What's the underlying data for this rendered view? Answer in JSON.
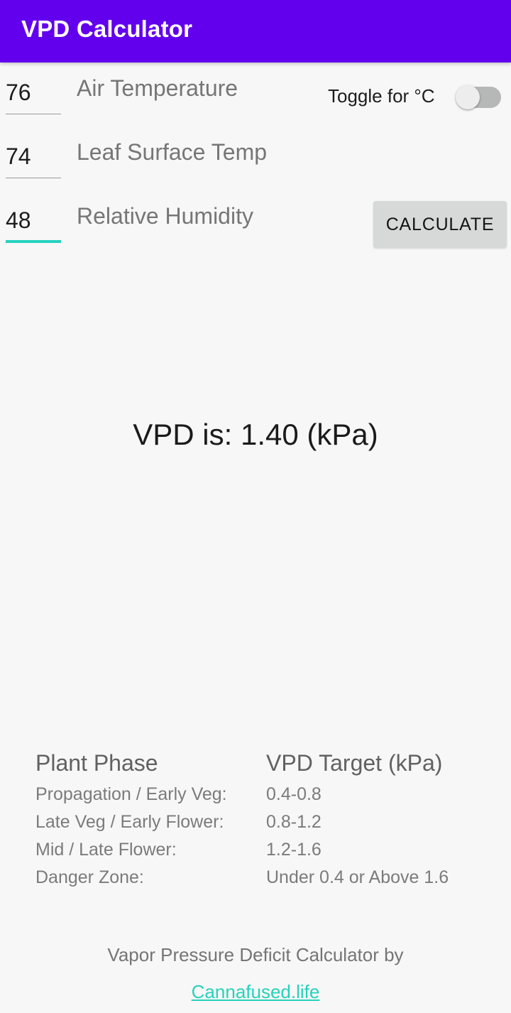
{
  "appbar": {
    "title": "VPD Calculator",
    "background_color": "#6200ee",
    "title_color": "#ffffff"
  },
  "theme": {
    "background_color": "#f7f7f7",
    "accent_color": "#26d2c0",
    "link_color": "#26d2bb",
    "label_color": "#767676",
    "button_color": "#d7d8d8"
  },
  "form": {
    "fields": [
      {
        "name": "air-temperature",
        "value": "76",
        "placeholder": "",
        "label": "Air Temperature",
        "focused": false
      },
      {
        "name": "leaf-surface-temp",
        "value": "74",
        "placeholder": "",
        "label": "Leaf Surface Temp",
        "focused": false
      },
      {
        "name": "relative-humidity",
        "value": "48",
        "placeholder": "",
        "label": "Relative Humidity",
        "focused": true
      }
    ],
    "toggle": {
      "label": "Toggle for °C",
      "state": "off"
    },
    "calculate_label": "CALCULATE"
  },
  "result": {
    "text": "VPD is: 1.40 (kPa)",
    "value": "1.40",
    "unit": "kPa"
  },
  "reference": {
    "headers": [
      "Plant Phase",
      "VPD Target (kPa)"
    ],
    "rows": [
      {
        "phase": "Propagation / Early Veg:",
        "target": "0.4-0.8"
      },
      {
        "phase": "Late Veg / Early Flower:",
        "target": "0.8-1.2"
      },
      {
        "phase": "Mid / Late Flower:",
        "target": "1.2-1.6"
      },
      {
        "phase": "Danger Zone:",
        "target": "Under 0.4 or Above 1.6"
      }
    ]
  },
  "footer": {
    "text": "Vapor Pressure Deficit Calculator by",
    "link_label": "Cannafused.life"
  }
}
